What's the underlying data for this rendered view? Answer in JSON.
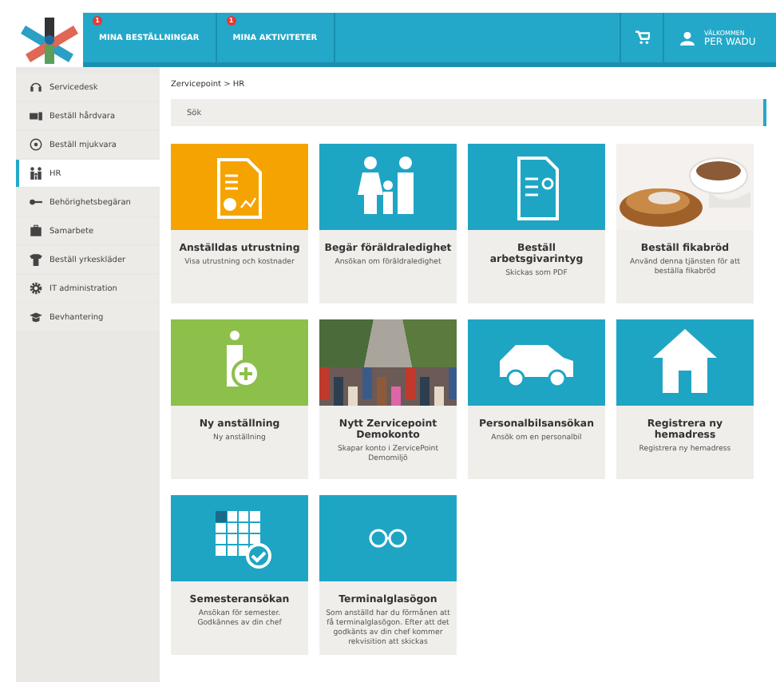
{
  "header": {
    "nav": [
      {
        "label": "MINA BESTÄLLNINGAR",
        "badge": "1"
      },
      {
        "label": "MINA AKTIVITETER",
        "badge": "1"
      }
    ],
    "welcome": "VÄLKOMMEN",
    "user": "PER WADU"
  },
  "sidebar": {
    "items": [
      {
        "label": "Servicedesk",
        "selected": false
      },
      {
        "label": "Beställ hårdvara",
        "selected": false
      },
      {
        "label": "Beställ mjukvara",
        "selected": false
      },
      {
        "label": "HR",
        "selected": true
      },
      {
        "label": "Behörighetsbegäran",
        "selected": false
      },
      {
        "label": "Samarbete",
        "selected": false
      },
      {
        "label": "Beställ yrkeskläder",
        "selected": false
      },
      {
        "label": "IT administration",
        "selected": false
      },
      {
        "label": "Bevhantering",
        "selected": false
      }
    ]
  },
  "breadcrumb": "Zervicepoint > HR",
  "search": {
    "placeholder": "Sök"
  },
  "tiles": [
    {
      "kind": "icon",
      "color": "#f5a300",
      "title": "Anställdas utrustning",
      "description": "Visa utrustning och kostnader"
    },
    {
      "kind": "icon",
      "color": "#1fa5c4",
      "title": "Begär föräldraledighet",
      "description": "Ansökan om föräldraledighet"
    },
    {
      "kind": "icon",
      "color": "#1fa5c4",
      "title": "Beställ arbetsgivarintyg",
      "description": "Skickas som PDF"
    },
    {
      "kind": "picture",
      "title": "Beställ fikabröd",
      "description": "Använd denna tjänsten för att beställa fikabröd"
    },
    {
      "kind": "icon",
      "color": "#8cc04b",
      "title": "Ny anställning",
      "description": "Ny anställning"
    },
    {
      "kind": "picture",
      "title": "Nytt Zervicepoint Demokonto",
      "description": "Skapar konto i ZervicePoint Demomiljö"
    },
    {
      "kind": "icon",
      "color": "#1fa5c4",
      "title": "Personalbilsansökan",
      "description": "Ansök om en personalbil"
    },
    {
      "kind": "icon",
      "color": "#1fa5c4",
      "title": "Registrera ny hemadress",
      "description": "Registrera ny hemadress"
    },
    {
      "kind": "icon",
      "color": "#1fa5c4",
      "title": "Semesteransökan",
      "description": "Ansökan för semester. Godkännes av din chef"
    },
    {
      "kind": "icon",
      "color": "#1fa5c4",
      "title": "Terminalglasögon",
      "description": "Som anställd har du förmånen att få terminalglasögon. Efter att det godkänts av din chef kommer rekvisition att skickas"
    }
  ]
}
